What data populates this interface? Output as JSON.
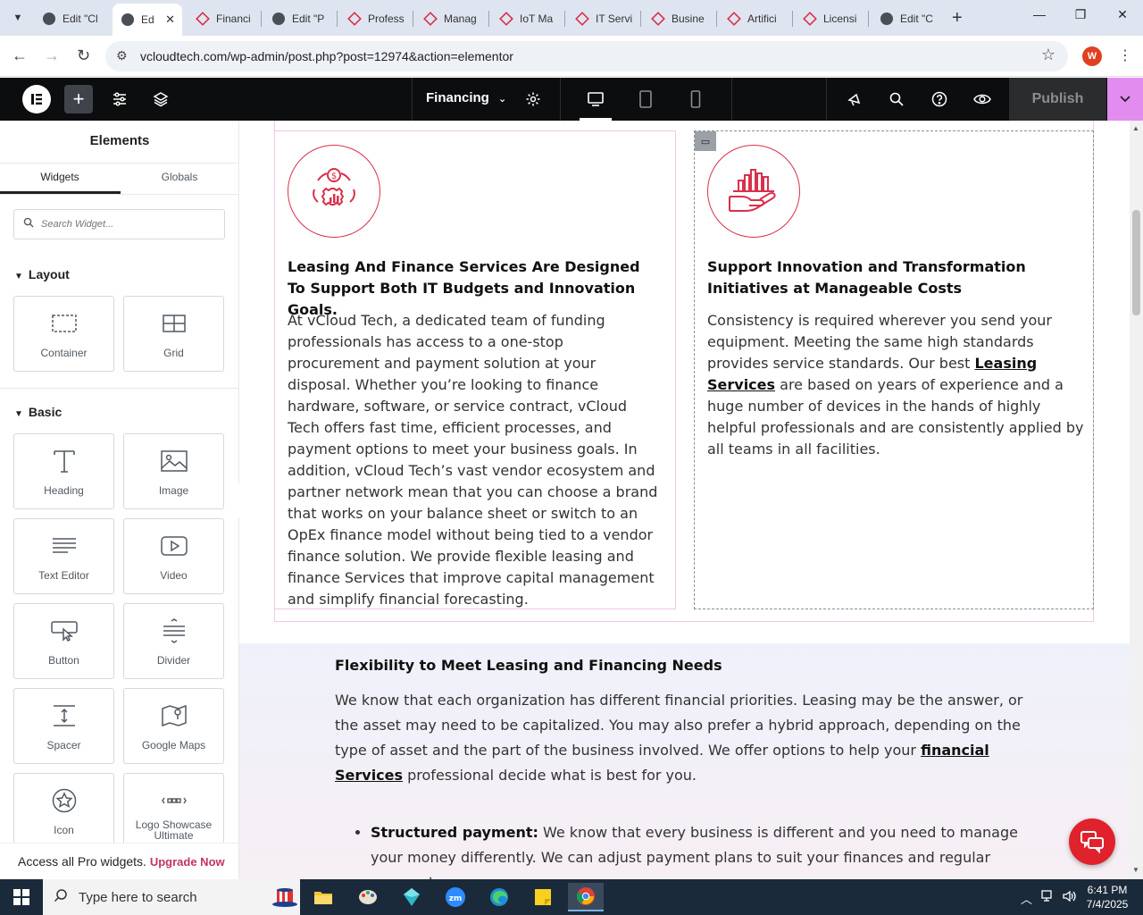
{
  "browser": {
    "tabs": [
      {
        "label": "Edit \"Cl",
        "favicon": "wordpress"
      },
      {
        "label": "Ed",
        "favicon": "wordpress",
        "active": true
      },
      {
        "label": "Financi",
        "favicon": "elementor"
      },
      {
        "label": "Edit \"P",
        "favicon": "wordpress"
      },
      {
        "label": "Profess",
        "favicon": "elementor"
      },
      {
        "label": "Manag",
        "favicon": "elementor"
      },
      {
        "label": "IoT Ma",
        "favicon": "elementor"
      },
      {
        "label": "IT Servi",
        "favicon": "elementor"
      },
      {
        "label": "Busine",
        "favicon": "elementor"
      },
      {
        "label": "Artifici",
        "favicon": "elementor"
      },
      {
        "label": "Licensi",
        "favicon": "elementor"
      },
      {
        "label": "Edit \"C",
        "favicon": "wordpress"
      }
    ],
    "url": "vcloudtech.com/wp-admin/post.php?post=12974&action=elementor",
    "profile_initial": "W"
  },
  "topbar": {
    "document_title": "Financing",
    "publish_label": "Publish"
  },
  "panel": {
    "title": "Elements",
    "tabs": [
      "Widgets",
      "Globals"
    ],
    "search_placeholder": "Search Widget...",
    "layout_heading": "Layout",
    "basic_heading": "Basic",
    "layout_widgets": [
      {
        "label": "Container",
        "icon": "container-icon"
      },
      {
        "label": "Grid",
        "icon": "grid-icon"
      }
    ],
    "basic_widgets": [
      {
        "label": "Heading",
        "icon": "heading-icon"
      },
      {
        "label": "Image",
        "icon": "image-icon"
      },
      {
        "label": "Text Editor",
        "icon": "text-editor-icon"
      },
      {
        "label": "Video",
        "icon": "video-icon"
      },
      {
        "label": "Button",
        "icon": "button-icon"
      },
      {
        "label": "Divider",
        "icon": "divider-icon"
      },
      {
        "label": "Spacer",
        "icon": "spacer-icon"
      },
      {
        "label": "Google Maps",
        "icon": "map-icon"
      },
      {
        "label": "Icon",
        "icon": "star-icon"
      },
      {
        "label": "Logo Showcase Ultimate",
        "icon": "logo-showcase-icon"
      }
    ],
    "pro_text": "Access all Pro widgets.",
    "pro_link": "Upgrade Now"
  },
  "content": {
    "left_column": {
      "heading": "Leasing And Finance Services Are Designed To Support Both IT Budgets and Innovation Goals.",
      "body": "At vCloud Tech, a dedicated team of funding professionals has access to a one-stop procurement and payment solution at your disposal. Whether you’re looking to finance hardware, software, or service contract, vCloud Tech offers fast time, efficient processes, and payment options to meet your business goals. In addition, vCloud Tech’s vast vendor ecosystem and partner network mean that you can choose a brand that works on your balance sheet or switch to an OpEx finance model without being tied to a vendor finance solution. We provide flexible leasing and finance Services that improve capital management and simplify financial forecasting."
    },
    "right_column": {
      "heading": "Support Innovation and Transformation Initiatives at Manageable Costs",
      "body_before": "Consistency is required wherever you send your equipment. Meeting the same high standards provides service standards. Our best ",
      "body_link": "Leasing Services",
      "body_after": " are based on years of experience and a huge number of devices in the hands of highly helpful professionals and are consistently applied by all teams in all facilities."
    },
    "lower": {
      "heading": "Flexibility to Meet Leasing and Financing Needs",
      "body_before": "We know that each organization has different financial priorities. Leasing may be the answer, or the asset may need to be capitalized. You may also prefer a hybrid approach, depending on the type of asset and the part of the business involved. We offer options to help your ",
      "body_link": "financial Services",
      "body_after": " professional decide what is best for you.",
      "bullet_label": "Structured payment:",
      "bullet_text": " We know that every business is different and you need to manage your money differently. We can adjust payment plans to suit your finances and regular payment"
    }
  },
  "taskbar": {
    "search_placeholder": "Type here to search",
    "time": "6:41 PM",
    "date": "7/4/2025"
  },
  "colors": {
    "accent": "#d9304c",
    "publish_more": "#e28cf0",
    "chat": "#e0222c",
    "taskbar": "#1b2a3a"
  }
}
